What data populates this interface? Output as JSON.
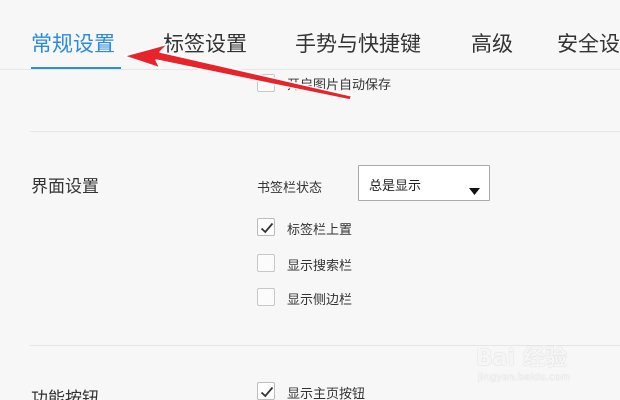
{
  "tabs": [
    {
      "label": "常规设置"
    },
    {
      "label": "标签设置"
    },
    {
      "label": "手势与快捷键"
    },
    {
      "label": "高级"
    },
    {
      "label": "安全设"
    }
  ],
  "general": {
    "image_autosave_label": "开启图片自动保存"
  },
  "interface": {
    "title": "界面设置",
    "bookmark_bar_label": "书签栏状态",
    "bookmark_bar_value": "总是显示",
    "tabbar_top_label": "标签栏上置",
    "show_search_label": "显示搜索栏",
    "show_sidebar_label": "显示侧边栏"
  },
  "function_buttons": {
    "title": "功能按钮",
    "show_home_label": "显示主页按钮"
  },
  "watermark": {
    "main": "Bai 经验",
    "sub": "jingyan.baidu.com"
  },
  "colors": {
    "accent": "#2a8be0",
    "arrow": "#e8232a"
  }
}
